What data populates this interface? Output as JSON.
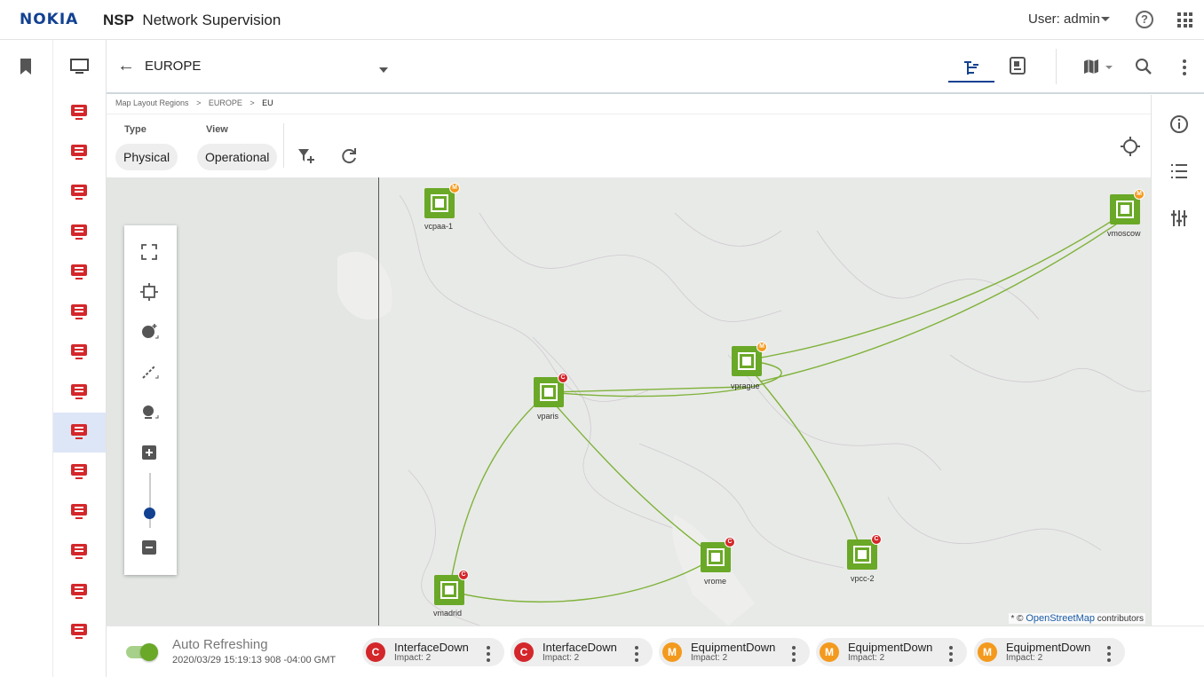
{
  "app": {
    "logo": "NOKIA",
    "product": "NSP",
    "title": "Network Supervision",
    "user_label": "User: admin"
  },
  "header": {
    "region_title": "EUROPE"
  },
  "breadcrumb": [
    "Map Layout Regions",
    "EUROPE",
    "EU"
  ],
  "filters": {
    "type_label": "Type",
    "type_value": "Physical",
    "view_label": "View",
    "view_value": "Operational"
  },
  "left_nav": {
    "device_count": 14,
    "selected_index": 8
  },
  "map": {
    "attribution_prefix": "* ©",
    "attribution_link": "OpenStreetMap",
    "attribution_suffix": "contributors",
    "link_color": "#7fb23a",
    "nodes": [
      {
        "name": "vcpaa-1",
        "badge": "M",
        "badge_color": "#f39a1e"
      },
      {
        "name": "vmoscow",
        "badge": "M",
        "badge_color": "#f39a1e"
      },
      {
        "name": "vprague",
        "badge": "M",
        "badge_color": "#f39a1e"
      },
      {
        "name": "vparis",
        "badge": "C",
        "badge_color": "#d4272b"
      },
      {
        "name": "vrome",
        "badge": "C",
        "badge_color": "#d4272b"
      },
      {
        "name": "vpcc-2",
        "badge": "C",
        "badge_color": "#d4272b"
      },
      {
        "name": "vmadrid",
        "badge": "C",
        "badge_color": "#d4272b"
      }
    ],
    "zoom_level_fraction": 0.25
  },
  "bottom": {
    "auto_label": "Auto Refreshing",
    "auto_time": "2020/03/29 15:19:13 908 -04:00 GMT",
    "auto_on": true,
    "alarms": [
      {
        "severity": "C",
        "color": "#d4272b",
        "name": "InterfaceDown",
        "impact": "Impact: 2"
      },
      {
        "severity": "C",
        "color": "#d4272b",
        "name": "InterfaceDown",
        "impact": "Impact: 2"
      },
      {
        "severity": "M",
        "color": "#f39a1e",
        "name": "EquipmentDown",
        "impact": "Impact: 2"
      },
      {
        "severity": "M",
        "color": "#f39a1e",
        "name": "EquipmentDown",
        "impact": "Impact: 2"
      },
      {
        "severity": "M",
        "color": "#f39a1e",
        "name": "EquipmentDown",
        "impact": "Impact: 2"
      }
    ]
  },
  "colors": {
    "brand": "#124191",
    "critical": "#d4272b",
    "major": "#f39a1e",
    "node_green": "#6aa827",
    "selected_nav": "#dde6f6"
  }
}
